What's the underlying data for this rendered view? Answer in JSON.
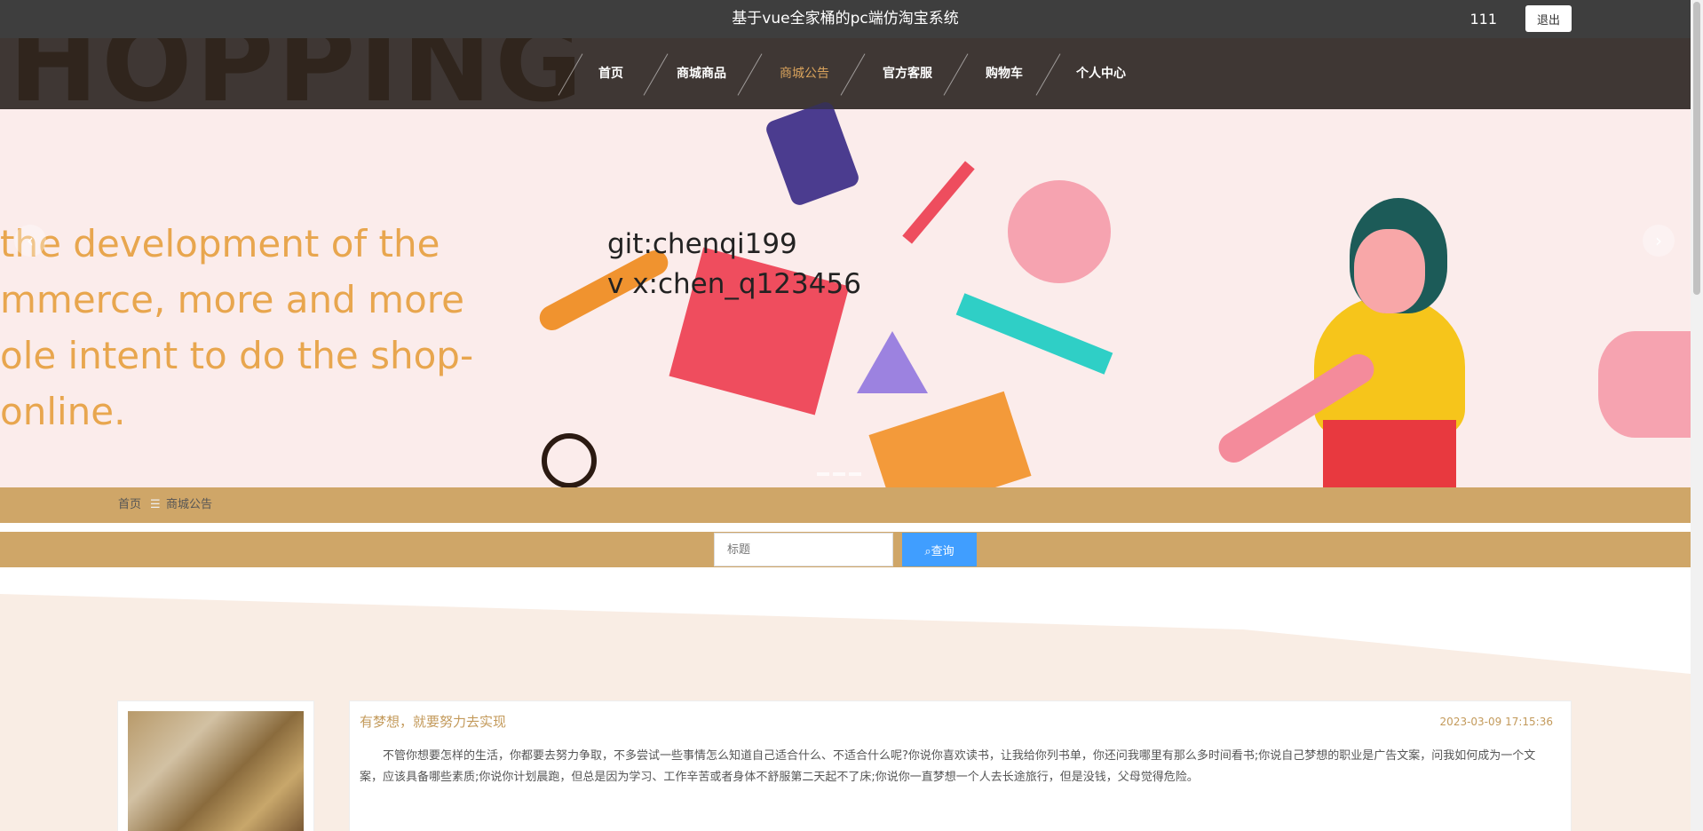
{
  "header": {
    "title": "基于vue全家桶的pc端仿淘宝系统",
    "username": "111",
    "logout_label": "退出"
  },
  "nav": {
    "items": [
      {
        "label": "首页",
        "active": false
      },
      {
        "label": "商城商品",
        "active": false
      },
      {
        "label": "商城公告",
        "active": true
      },
      {
        "label": "官方客服",
        "active": false
      },
      {
        "label": "购物车",
        "active": false
      },
      {
        "label": "个人中心",
        "active": false
      }
    ]
  },
  "banner": {
    "big_text": "HOPPING",
    "lines": [
      "the development of the",
      "mmerce, more and more",
      "ole intent to do the shop-",
      "online."
    ],
    "overlay_lines": [
      "git:chenqi199",
      "v x:chen_q123456"
    ]
  },
  "breadcrumb": {
    "home": "首页",
    "separator": "☰",
    "current": "商城公告"
  },
  "search": {
    "placeholder": "标题",
    "button_label": "查询"
  },
  "notice": {
    "title": "有梦想，就要努力去实现",
    "date": "2023-03-09 17:15:36",
    "content": "不管你想要怎样的生活，你都要去努力争取，不多尝试一些事情怎么知道自己适合什么、不适合什么呢?你说你喜欢读书，让我给你列书单，你还问我哪里有那么多时间看书;你说自己梦想的职业是广告文案，问我如何成为一个文案，应该具备哪些素质;你说你计划晨跑，但总是因为学习、工作辛苦或者身体不舒服第二天起不了床;你说你一直梦想一个人去长途旅行，但是没钱，父母觉得危险。"
  },
  "colors": {
    "topbar": "#3e3e3e",
    "accent": "#cfa668",
    "active_nav": "#d9a35c",
    "button": "#409eff"
  }
}
